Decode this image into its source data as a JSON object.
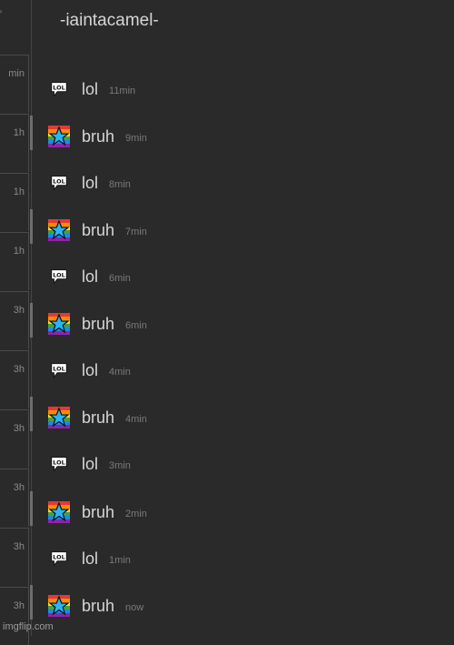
{
  "header": {
    "title": "-iaintacamel-"
  },
  "left_times": [
    "min",
    "1h",
    "1h",
    "1h",
    "3h",
    "3h",
    "3h",
    "3h",
    "3h",
    "3h"
  ],
  "messages": [
    {
      "name": "lol",
      "time": "11min",
      "avatar": "lol-speech-bubble-icon"
    },
    {
      "name": "bruh",
      "time": "9min",
      "avatar": "rainbow-star-icon"
    },
    {
      "name": "lol",
      "time": "8min",
      "avatar": "lol-speech-bubble-icon"
    },
    {
      "name": "bruh",
      "time": "7min",
      "avatar": "rainbow-star-icon"
    },
    {
      "name": "lol",
      "time": "6min",
      "avatar": "lol-speech-bubble-icon"
    },
    {
      "name": "bruh",
      "time": "6min",
      "avatar": "rainbow-star-icon"
    },
    {
      "name": "lol",
      "time": "4min",
      "avatar": "lol-speech-bubble-icon"
    },
    {
      "name": "bruh",
      "time": "4min",
      "avatar": "rainbow-star-icon"
    },
    {
      "name": "lol",
      "time": "3min",
      "avatar": "lol-speech-bubble-icon"
    },
    {
      "name": "bruh",
      "time": "2min",
      "avatar": "rainbow-star-icon"
    },
    {
      "name": "lol",
      "time": "1min",
      "avatar": "lol-speech-bubble-icon"
    },
    {
      "name": "bruh",
      "time": "now",
      "avatar": "rainbow-star-icon"
    }
  ],
  "footer": {
    "text": "imgflip.com"
  }
}
